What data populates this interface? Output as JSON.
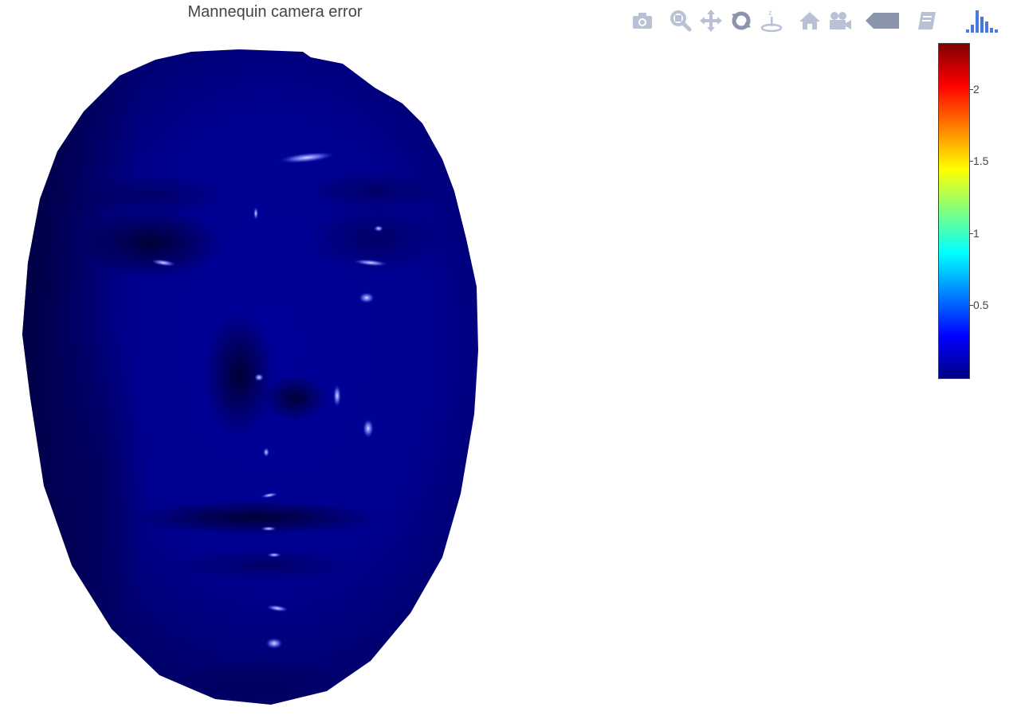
{
  "chart_data": {
    "type": "surface",
    "title": "Mannequin camera error",
    "colorscale": "jet",
    "cmin": 0,
    "cmax": 2.32,
    "surface_values_range": [
      0,
      0.2
    ],
    "colorbar": {
      "ticks": [
        {
          "value": 0.5,
          "label": "0.5"
        },
        {
          "value": 1,
          "label": "1"
        },
        {
          "value": 1.5,
          "label": "1.5"
        },
        {
          "value": 2,
          "label": "2"
        }
      ],
      "colors": [
        "#000083",
        "#0000ff",
        "#0080ff",
        "#00ffff",
        "#80ff80",
        "#ffff00",
        "#ff8000",
        "#ff0000",
        "#800000"
      ]
    },
    "surface_color_base": "#000093"
  },
  "modebar": {
    "buttons": [
      {
        "name": "download-plot-button",
        "icon": "camera-icon",
        "tooltip": "Download plot as a png"
      },
      {
        "name": "zoom-button",
        "icon": "zoom-icon",
        "tooltip": "Zoom"
      },
      {
        "name": "pan-button",
        "icon": "pan-icon",
        "tooltip": "Pan"
      },
      {
        "name": "orbit-rotation-button",
        "icon": "orbit-icon",
        "tooltip": "Orbital rotation"
      },
      {
        "name": "turntable-rotation-button",
        "icon": "turntable-icon",
        "tooltip": "Turntable rotation"
      },
      {
        "name": "reset-camera-default-button",
        "icon": "home-icon",
        "tooltip": "Reset camera to default"
      },
      {
        "name": "reset-camera-last-button",
        "icon": "video-camera-icon",
        "tooltip": "Reset camera to last save"
      },
      {
        "name": "toggle-hover-button",
        "icon": "tag-icon",
        "tooltip": "Toggle show closest data on hover"
      },
      {
        "name": "edit-chart-studio-button",
        "icon": "notebook-icon",
        "tooltip": "Edit in Chart Studio"
      },
      {
        "name": "plotly-logo-button",
        "icon": "plotly-logo-icon",
        "tooltip": "Produced with Plotly"
      }
    ],
    "icon_color": "#b9c2d5",
    "active_color": "#8a94ab",
    "logo_color": "#447adb"
  }
}
